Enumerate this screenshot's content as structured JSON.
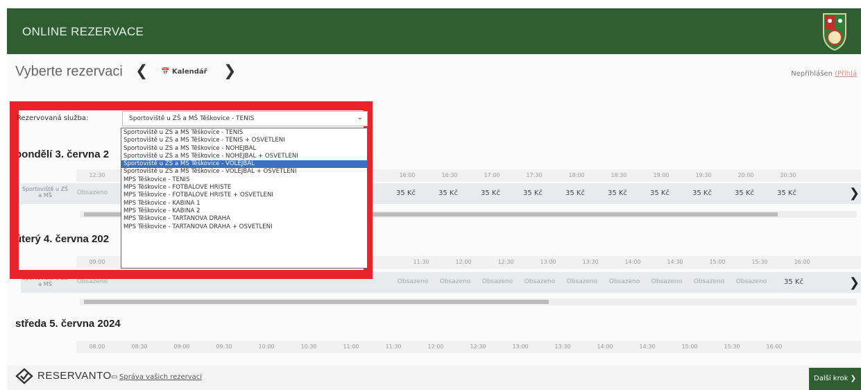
{
  "header": {
    "title": "ONLINE REZERVACE"
  },
  "toolbar": {
    "title": "Vyberte rezervaci",
    "prev": "❮",
    "next": "❯",
    "calendar": "📅 Kalendář"
  },
  "login": {
    "status": "Nepřihlášen",
    "link": "(Přihlá"
  },
  "service": {
    "label": "Rezervovaná služba:",
    "selected": "Sportoviště u ZŠ a MŠ Těškovice - TENIS",
    "options": [
      "Sportoviště u ZŠ a MŠ Těškovice - TENIS",
      "Sportoviště u ZŠ a MŠ Těškovice - TENIS + OSVĚTLENÍ",
      "Sportoviště u ZŠ a MŠ Těškovice - NOHEJBAL",
      "Sportoviště u ZŠ a MŠ Těškovice - NOHEJBAL + OSVĚTLENÍ",
      "Sportoviště u ZŠ a MŠ Těškovice - VOLEJBAL",
      "Sportoviště u ZŠ a MŠ Těškovice - VOLEJBAL + OSVĚTLENÍ",
      "MPS Těškovice - TENIS",
      "MPS Těškovice - FOTBALOVÉ HŘIŠTĚ",
      "MPS Těškovice - FOTBALOVÉ HŘIŠTĚ + OSVĚTLENÍ",
      "MPS Těškovice - KABINA 1",
      "MPS Těškovice - KABINA 2",
      "MPS Těškovice - TARTANOVÁ DRÁHA",
      "MPS Těškovice - TARTANOVÁ DRÁHA + OSVĚTLENÍ"
    ],
    "highlighted_index": 4
  },
  "days": [
    {
      "title": "pondělí 3. června 2",
      "venue": "Sportoviště u ZŠ a MŠ",
      "times": [
        "12:30",
        "16:00",
        "16:30",
        "17:00",
        "17:30",
        "18:00",
        "18:30",
        "19:00",
        "19:30",
        "20:00",
        "20:30"
      ],
      "slots": [
        "Obsazeno",
        "35 Kč",
        "35 Kč",
        "35 Kč",
        "35 Kč",
        "35 Kč",
        "35 Kč",
        "35 Kč",
        "35 Kč",
        "35 Kč",
        "35 Kč"
      ]
    },
    {
      "title": "úterý 4. června 202",
      "venue": "Sportoviště u ZŠ a MŠ",
      "times": [
        "09:00",
        "11:30",
        "12:00",
        "12:30",
        "13:00",
        "13:30",
        "14:00",
        "14:30",
        "15:00",
        "15:30",
        "16:00"
      ],
      "slots": [
        "Obsazeno",
        "Obsazeno",
        "Obsazeno",
        "Obsazeno",
        "Obsazeno",
        "Obsazeno",
        "Obsazeno",
        "Obsazeno",
        "Obsazeno",
        "Obsazeno",
        "35 Kč"
      ]
    },
    {
      "title": "středa 5. června 2024",
      "times": [
        "08:00",
        "08:30",
        "09:00",
        "09:30",
        "10:00",
        "10:30",
        "11:00",
        "11:30",
        "12:00",
        "12:30",
        "13:00",
        "13:30",
        "14:00",
        "14:30",
        "15:00",
        "15:30",
        "16:00"
      ]
    }
  ],
  "footer": {
    "brand": "RESERVANTO",
    "my_reservations": "Správa vašich rezervací",
    "next_step": "Další krok ❯"
  },
  "colors": {
    "header": "#2e5e32",
    "highlight_box": "#e8232a",
    "option_selected": "#3a6fc4"
  }
}
